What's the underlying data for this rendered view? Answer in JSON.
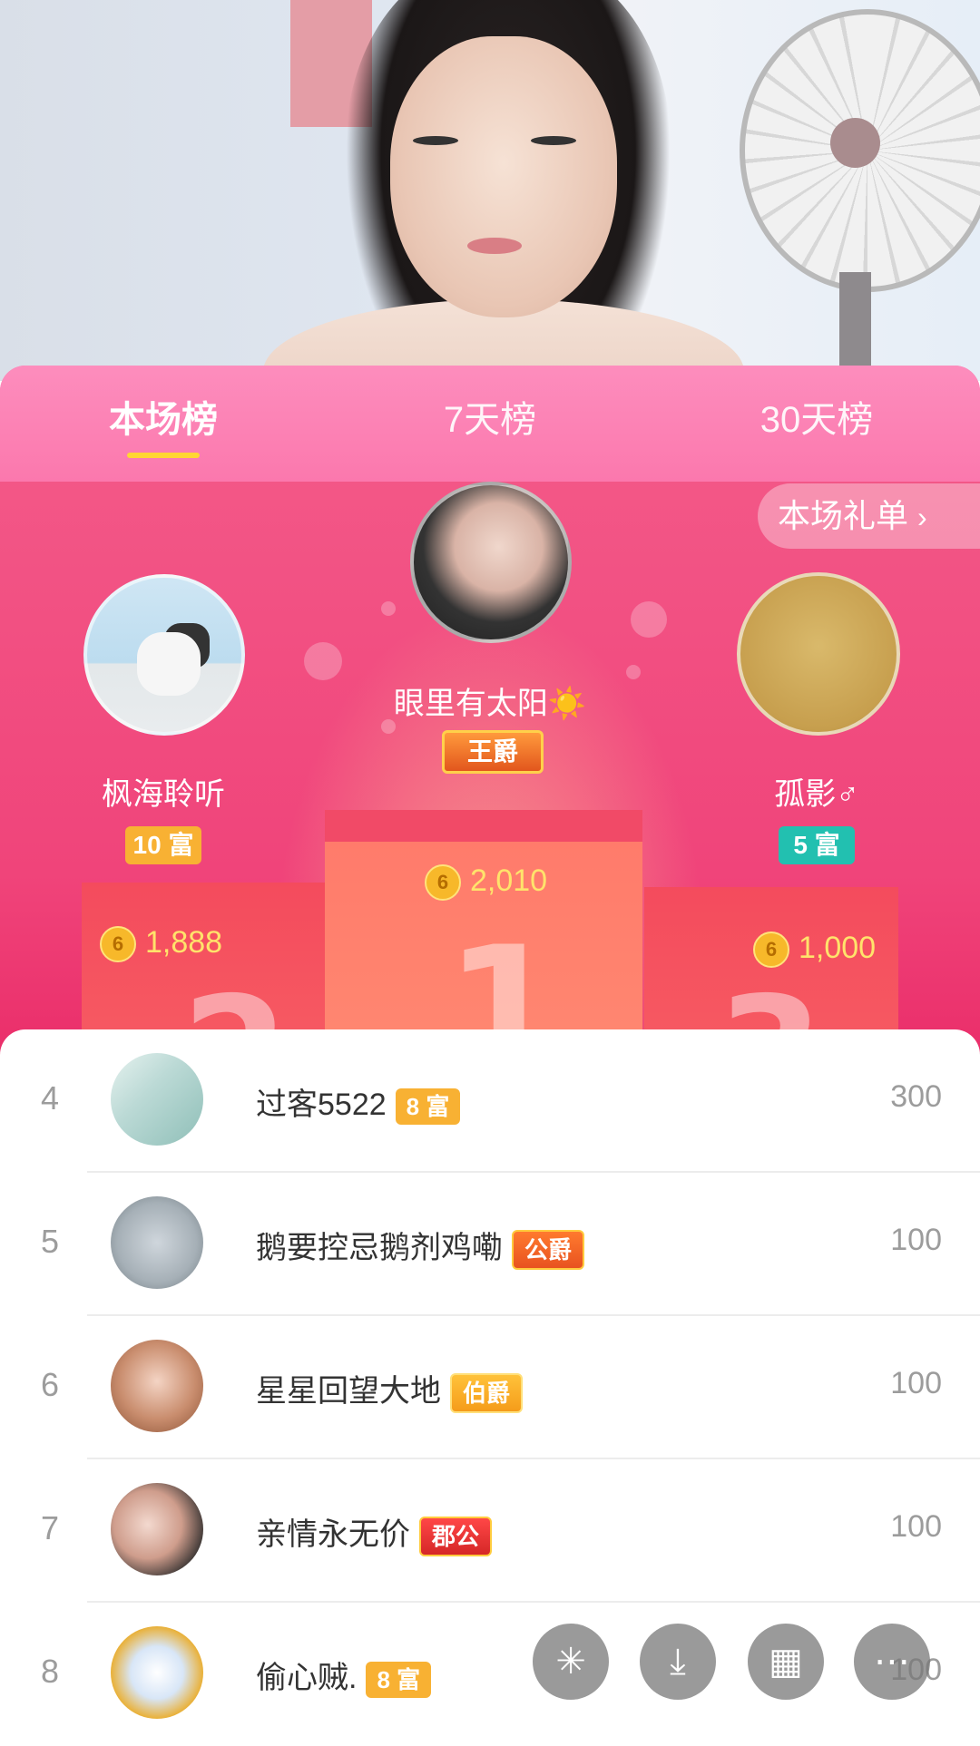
{
  "tabs": [
    "本场榜",
    "7天榜",
    "30天榜"
  ],
  "gift_list_button": "本场礼单",
  "top3": {
    "first": {
      "name": "眼里有太阳☀️",
      "badge": "王爵",
      "coins": "2,010",
      "rank": "1"
    },
    "second": {
      "name": "枫海聆听",
      "badge": "10 富",
      "coins": "1,888",
      "rank": "2"
    },
    "third": {
      "name": "孤影♂",
      "badge": "5 富",
      "coins": "1,000",
      "rank": "3"
    }
  },
  "coin_icon_glyph": "6",
  "list": [
    {
      "rank": "4",
      "name": "过客5522",
      "badge": "8 富",
      "value": "300"
    },
    {
      "rank": "5",
      "name": "鹅要控忌鹅剂鸡嘞",
      "badge": "公爵",
      "value": "100"
    },
    {
      "rank": "6",
      "name": "星星回望大地",
      "badge": "伯爵",
      "value": "100"
    },
    {
      "rank": "7",
      "name": "亲情永无价",
      "badge": "郡公",
      "value": "100"
    },
    {
      "rank": "8",
      "name": "偷心贼.",
      "badge": "8 富",
      "value": "100"
    }
  ],
  "fabs": [
    "sparkle-icon",
    "download-icon",
    "grid-icon",
    "more-icon"
  ],
  "colors": {
    "panel_pink": "#f0447a",
    "tab_pink": "#fb78ad",
    "tab_underline": "#ffd633",
    "rich_badge": "#f8b133",
    "teal_badge": "#22c0b0"
  }
}
